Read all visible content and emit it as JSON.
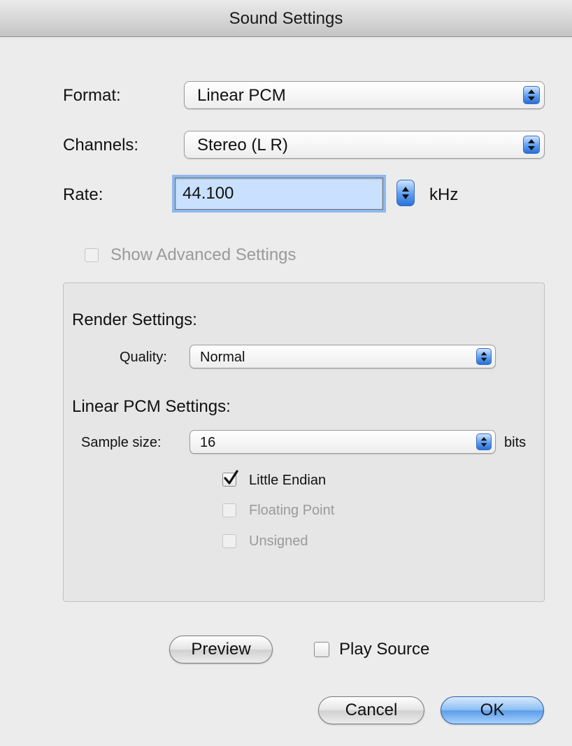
{
  "window": {
    "title": "Sound Settings"
  },
  "format": {
    "label": "Format:",
    "value": "Linear PCM"
  },
  "channels": {
    "label": "Channels:",
    "value": "Stereo (L R)"
  },
  "rate": {
    "label": "Rate:",
    "value": "44.100",
    "unit": "kHz"
  },
  "advanced": {
    "label": "Show Advanced Settings",
    "checked": false,
    "enabled": false
  },
  "render": {
    "title": "Render Settings:",
    "quality_label": "Quality:",
    "quality_value": "Normal"
  },
  "linear_pcm": {
    "title": "Linear PCM Settings:",
    "sample_size_label": "Sample size:",
    "sample_size_value": "16",
    "sample_size_unit": "bits",
    "options": [
      {
        "label": "Little Endian",
        "checked": true,
        "enabled": true
      },
      {
        "label": "Floating Point",
        "checked": false,
        "enabled": false
      },
      {
        "label": "Unsigned",
        "checked": false,
        "enabled": false
      }
    ]
  },
  "footer": {
    "preview_label": "Preview",
    "play_source_label": "Play Source",
    "cancel_label": "Cancel",
    "ok_label": "OK"
  },
  "icons": {
    "popup_arrows": "up-down-arrows-icon",
    "checkmark": "checkmark-icon"
  },
  "colors": {
    "accent": "#5d9df0",
    "focus_ring": "#8fb9ef",
    "field_selection": "#c9e0ff"
  }
}
